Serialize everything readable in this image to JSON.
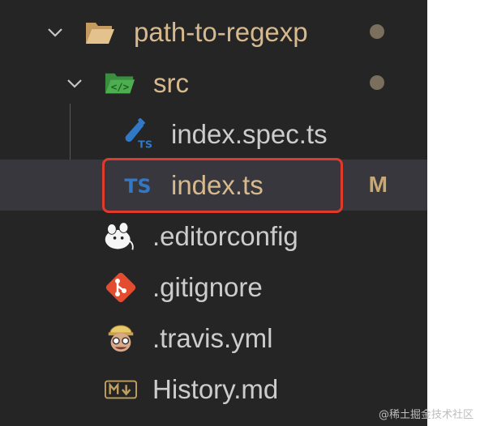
{
  "explorer": {
    "items": [
      {
        "name": "path-to-regexp",
        "kind": "folder-open",
        "icon": "folder-open-icon",
        "color": "#d7b98e",
        "status": "dot"
      },
      {
        "name": "src",
        "kind": "folder-src-open",
        "icon": "folder-src-icon",
        "color": "#d7b98e",
        "status": "dot"
      },
      {
        "name": "index.spec.ts",
        "kind": "file",
        "icon": "ts-test-icon",
        "color": "#cccccc"
      },
      {
        "name": "index.ts",
        "kind": "file",
        "icon": "typescript-icon",
        "color": "#d7b98e",
        "status": "M",
        "selected": true
      },
      {
        "name": ".editorconfig",
        "kind": "file",
        "icon": "editorconfig-icon",
        "color": "#cccccc"
      },
      {
        "name": ".gitignore",
        "kind": "file",
        "icon": "git-icon",
        "color": "#cccccc"
      },
      {
        "name": ".travis.yml",
        "kind": "file",
        "icon": "travis-icon",
        "color": "#cccccc"
      },
      {
        "name": "History.md",
        "kind": "file",
        "icon": "markdown-icon",
        "color": "#cccccc"
      }
    ],
    "status_modified": "M"
  },
  "colors": {
    "highlight": "#e03a2c",
    "ts_blue": "#3178c6",
    "modified": "#c9a873"
  },
  "watermark": "@稀土掘金技术社区"
}
